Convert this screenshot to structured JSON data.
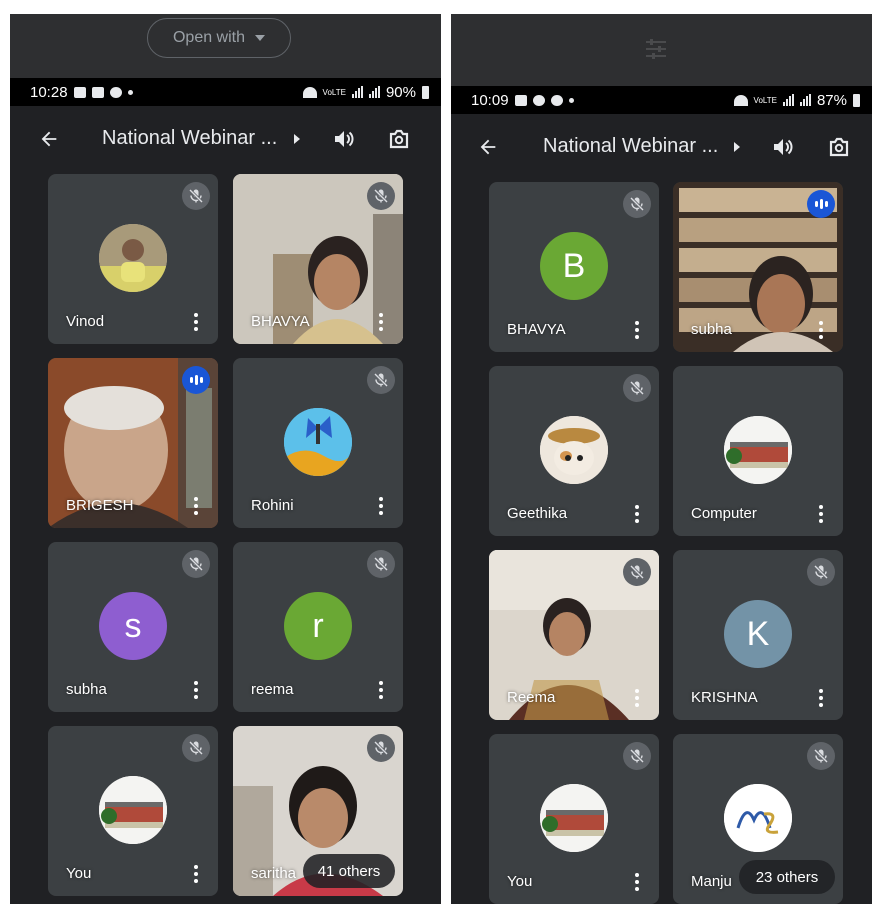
{
  "left": {
    "open_with_label": "Open with",
    "status": {
      "time": "10:28",
      "battery": "90%",
      "network": "VoLTE"
    },
    "meeting_title": "National Webinar ...",
    "tiles": [
      {
        "name": "Vinod",
        "state": "muted",
        "avatar": "photo"
      },
      {
        "name": "BHAVYA",
        "state": "muted",
        "avatar": "video"
      },
      {
        "name": "BRIGESH",
        "state": "speaking",
        "avatar": "video"
      },
      {
        "name": "Rohini",
        "state": "muted",
        "avatar": "butterfly"
      },
      {
        "name": "subha",
        "state": "muted",
        "avatar": "letter",
        "letter": "s",
        "color": "#8e5ed0"
      },
      {
        "name": "reema",
        "state": "muted",
        "avatar": "letter",
        "letter": "r",
        "color": "#6aa834"
      },
      {
        "name": "You",
        "state": "muted",
        "avatar": "building"
      },
      {
        "name": "saritha",
        "state": "muted",
        "avatar": "video"
      }
    ],
    "others_label": "41 others"
  },
  "right": {
    "status": {
      "time": "10:09",
      "battery": "87%",
      "network": "VoLTE"
    },
    "meeting_title": "National Webinar ...",
    "tiles": [
      {
        "name": "BHAVYA",
        "state": "muted",
        "avatar": "letter",
        "letter": "B",
        "color": "#6aa834"
      },
      {
        "name": "subha",
        "state": "speaking",
        "avatar": "video"
      },
      {
        "name": "Geethika",
        "state": "muted",
        "avatar": "kitten"
      },
      {
        "name": "Computer",
        "state": "none",
        "avatar": "building"
      },
      {
        "name": "Reema",
        "state": "muted",
        "avatar": "video"
      },
      {
        "name": "KRISHNA",
        "state": "muted",
        "avatar": "letter",
        "letter": "K",
        "color": "#7393a7"
      },
      {
        "name": "You",
        "state": "muted",
        "avatar": "building"
      },
      {
        "name": "Manju",
        "state": "muted",
        "avatar": "monogram"
      }
    ],
    "others_label": "23 others"
  },
  "colors": {
    "meet_bg": "#202124",
    "tile_bg": "#3c4043",
    "speaking_badge": "#1a56d6",
    "mute_badge": "#5f6368"
  }
}
